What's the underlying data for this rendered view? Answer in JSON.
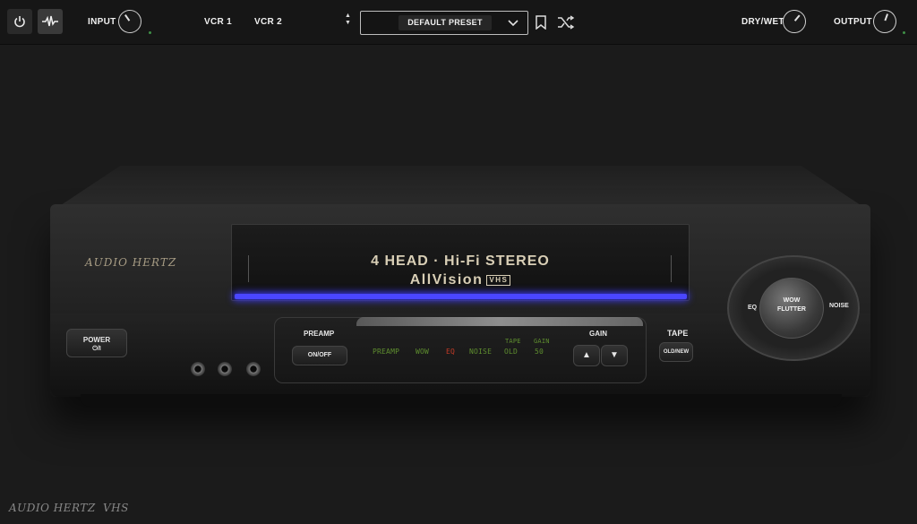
{
  "topbar": {
    "power_icon": "power-icon",
    "waveform_icon": "waveform-icon",
    "input_label": "INPUT",
    "vcr1_label": "VCR 1",
    "vcr2_label": "VCR 2",
    "preset_name": "DEFAULT PRESET",
    "drywet_label": "DRY/WET",
    "output_label": "OUTPUT",
    "accent_color": "#3f8f47"
  },
  "vcr": {
    "brand": "AUDIO HERTZ",
    "tape_line1": "4 HEAD · Hi-Fi STEREO",
    "tape_line2": "AllVision",
    "vhs_badge": "VHS",
    "power_label": "POWER",
    "power_sub": "⏻/I",
    "preamp_label": "PREAMP",
    "preamp_button": "ON/OFF",
    "gain_label": "GAIN",
    "gain_up": "▲",
    "gain_down": "▼",
    "tape_label": "TAPE",
    "tape_button": "OLD/NEW",
    "display": {
      "preamp": "PREAMP",
      "wow": "WOW",
      "eq": "EQ",
      "noise": "NOISE",
      "tape_title": "TAPE",
      "tape_value": "OLD",
      "gain_title": "GAIN",
      "gain_value": "50"
    },
    "ring": {
      "eq": "EQ",
      "center_line1": "WOW",
      "center_line2": "FLUTTER",
      "noise": "NOISE"
    }
  },
  "footer": {
    "brand": "AUDIO HERTZ",
    "product": "VHS"
  }
}
